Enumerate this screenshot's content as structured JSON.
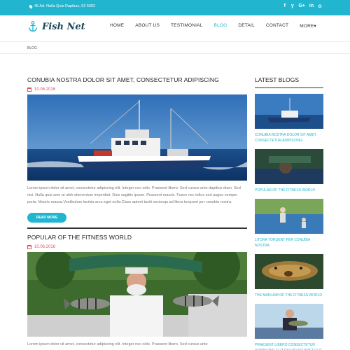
{
  "topbar": {
    "address": "45 Ad. Nulla Quis Dapibus, 52 5002",
    "social": [
      "f",
      "y",
      "G+",
      "in",
      "⊙"
    ]
  },
  "header": {
    "logo_text": "Fish Net",
    "nav": [
      "HOME",
      "ABOUT US",
      "TESTIMONIAL",
      "BLOG",
      "DETAIL",
      "CONTACT",
      "MORE▾"
    ],
    "active_nav": "BLOG"
  },
  "breadcrumb": "BLOG",
  "posts": [
    {
      "title": "CONUBIA NOSTRA DOLOR SIT AMET, CONSECTETUR ADIPISCING",
      "date": "10.06.2016",
      "excerpt": "Lorem ipsum dolor sit amet, consectetur adipiscing elit. Integer nec odio. Praesent libero. Sed cursus ante dapibus diam. Sed nisi. Nulla quis sem at nibh elementum imperdiet. Duis sagittis ipsum. Praesent mauris. Fusce nec tellus sed augue semper porta. Mauris massa.Vestibulum lacinia arcu eget nulla.Class aptent taciti sociosqu ad litora torquent per conubia nostra.",
      "button": "READ MORE"
    },
    {
      "title": "POPULAR OF THE FITNESS WORLD",
      "date": "10.06.2016",
      "excerpt": "Lorem ipsum dolor sit amet, consectetur adipiscing elit. Integer nec odio. Praesent libero. Sed cursus ante"
    }
  ],
  "sidebar": {
    "title": "LATEST BLOGS",
    "items": [
      {
        "label": "CONUBIA NOSTRA DOLOR SIT AMET, CONSECTETUR ADIPISCING"
      },
      {
        "label": "POPULAR OF THE FITNESS WORLD"
      },
      {
        "label": "LITORA TORQENT PER CONUBIA NOSTRA"
      },
      {
        "label": "THE MAIN AIM OF THE FITNESS WORLD"
      },
      {
        "label": "PRAESENT LIBERO CONSECTETUR ADIPISCING ELIT DOLOR SIT AMET ELIT INTERDIUM ODIO"
      }
    ]
  },
  "colors": {
    "accent": "#21b5cf",
    "date": "#e05060"
  }
}
